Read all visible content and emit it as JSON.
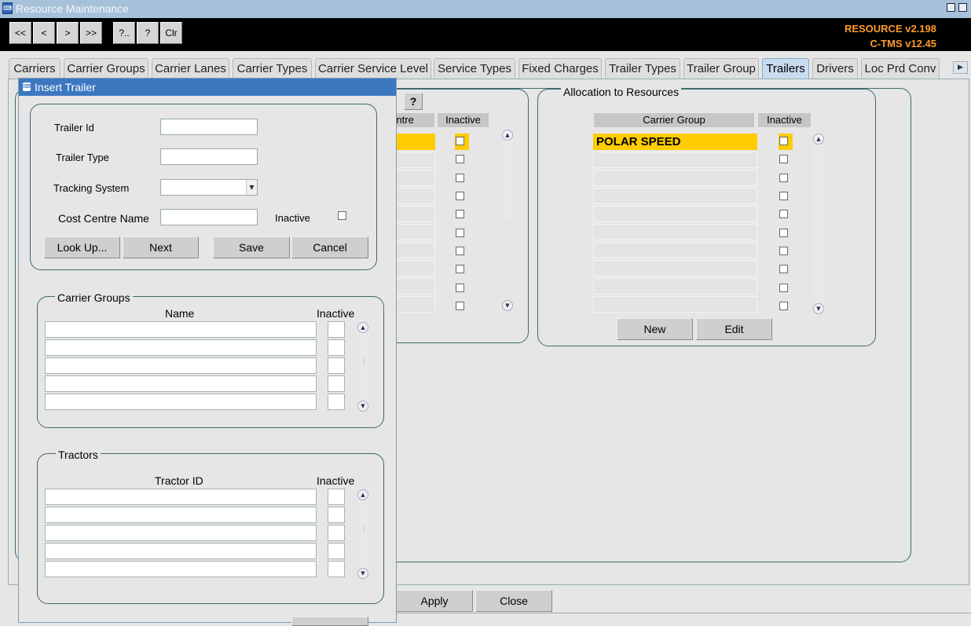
{
  "window": {
    "title": "Resource Maintenance"
  },
  "toolbar": {
    "buttons": [
      "<<",
      "<",
      ">",
      ">>",
      "?..",
      "?",
      "Clr"
    ],
    "version_resource": "RESOURCE v2.198",
    "version_ctms": "C-TMS v12.45"
  },
  "tabs": [
    "Carriers",
    "Carrier Groups",
    "Carrier Lanes",
    "Carrier Types",
    "Carrier Service Level",
    "Service Types",
    "Fixed Charges",
    "Trailer Types",
    "Trailer Group",
    "Trailers",
    "Drivers",
    "Loc Prd Conv"
  ],
  "active_tab": "Trailers",
  "background_grid": {
    "help_button": "?",
    "col_partial_header": "entre",
    "col_inactive_header": "Inactive"
  },
  "allocation": {
    "title": "Allocation to Resources",
    "col_carrier_group": "Carrier Group",
    "col_inactive": "Inactive",
    "rows": [
      "POLAR SPEED",
      "",
      "",
      "",
      "",
      "",
      "",
      "",
      "",
      ""
    ],
    "new_button": "New",
    "edit_button": "Edit"
  },
  "footer": {
    "apply_button": "Apply",
    "close_button": "Close"
  },
  "dialog": {
    "title": "Insert Trailer",
    "trailer_id_label": "Trailer Id",
    "trailer_type_label": "Trailer Type",
    "tracking_system_label": "Tracking System",
    "cost_centre_label": "Cost Centre Name",
    "inactive_label": "Inactive",
    "lookup_button": "Look Up...",
    "next_button": "Next",
    "save_button": "Save",
    "cancel_button": "Cancel",
    "carrier_groups": {
      "title": "Carrier Groups",
      "col_name": "Name",
      "col_inactive": "Inactive"
    },
    "tractors": {
      "title": "Tractors",
      "col_tractor_id": "Tractor ID",
      "col_inactive": "Inactive"
    }
  },
  "colors": {
    "highlight": "#ffcc00",
    "version_text": "#ff9a2e",
    "active_tab": "#c7dcef",
    "dialog_title": "#3c78c0"
  }
}
